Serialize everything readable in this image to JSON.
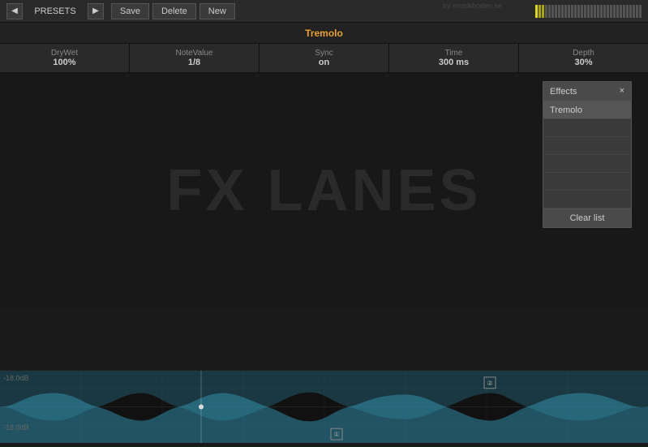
{
  "topbar": {
    "presets_label": "PRESETS",
    "save_label": "Save",
    "delete_label": "Delete",
    "new_label": "New",
    "prev_icon": "◀",
    "next_icon": "▶"
  },
  "title": {
    "label": "Tremolo"
  },
  "params": [
    {
      "name": "DryWet",
      "value": "100%"
    },
    {
      "name": "NoteValue",
      "value": "1/8"
    },
    {
      "name": "Sync",
      "value": "on"
    },
    {
      "name": "Time",
      "value": "300 ms"
    },
    {
      "name": "Depth",
      "value": "30%"
    }
  ],
  "fx_lanes": {
    "background_text": "FX LANES"
  },
  "effects_panel": {
    "title": "Effects",
    "close_label": "×",
    "items": [
      {
        "label": "Tremolo",
        "empty": false
      },
      {
        "label": "",
        "empty": true
      },
      {
        "label": "",
        "empty": true
      },
      {
        "label": "",
        "empty": true
      },
      {
        "label": "",
        "empty": true
      },
      {
        "label": "",
        "empty": true
      }
    ],
    "clear_label": "Clear list"
  },
  "waveform": {
    "db_top": "-18.0dB",
    "db_bottom": "-18.0dB",
    "marker1": "①",
    "marker2": "②"
  },
  "watermark": "by mustkboden.se"
}
